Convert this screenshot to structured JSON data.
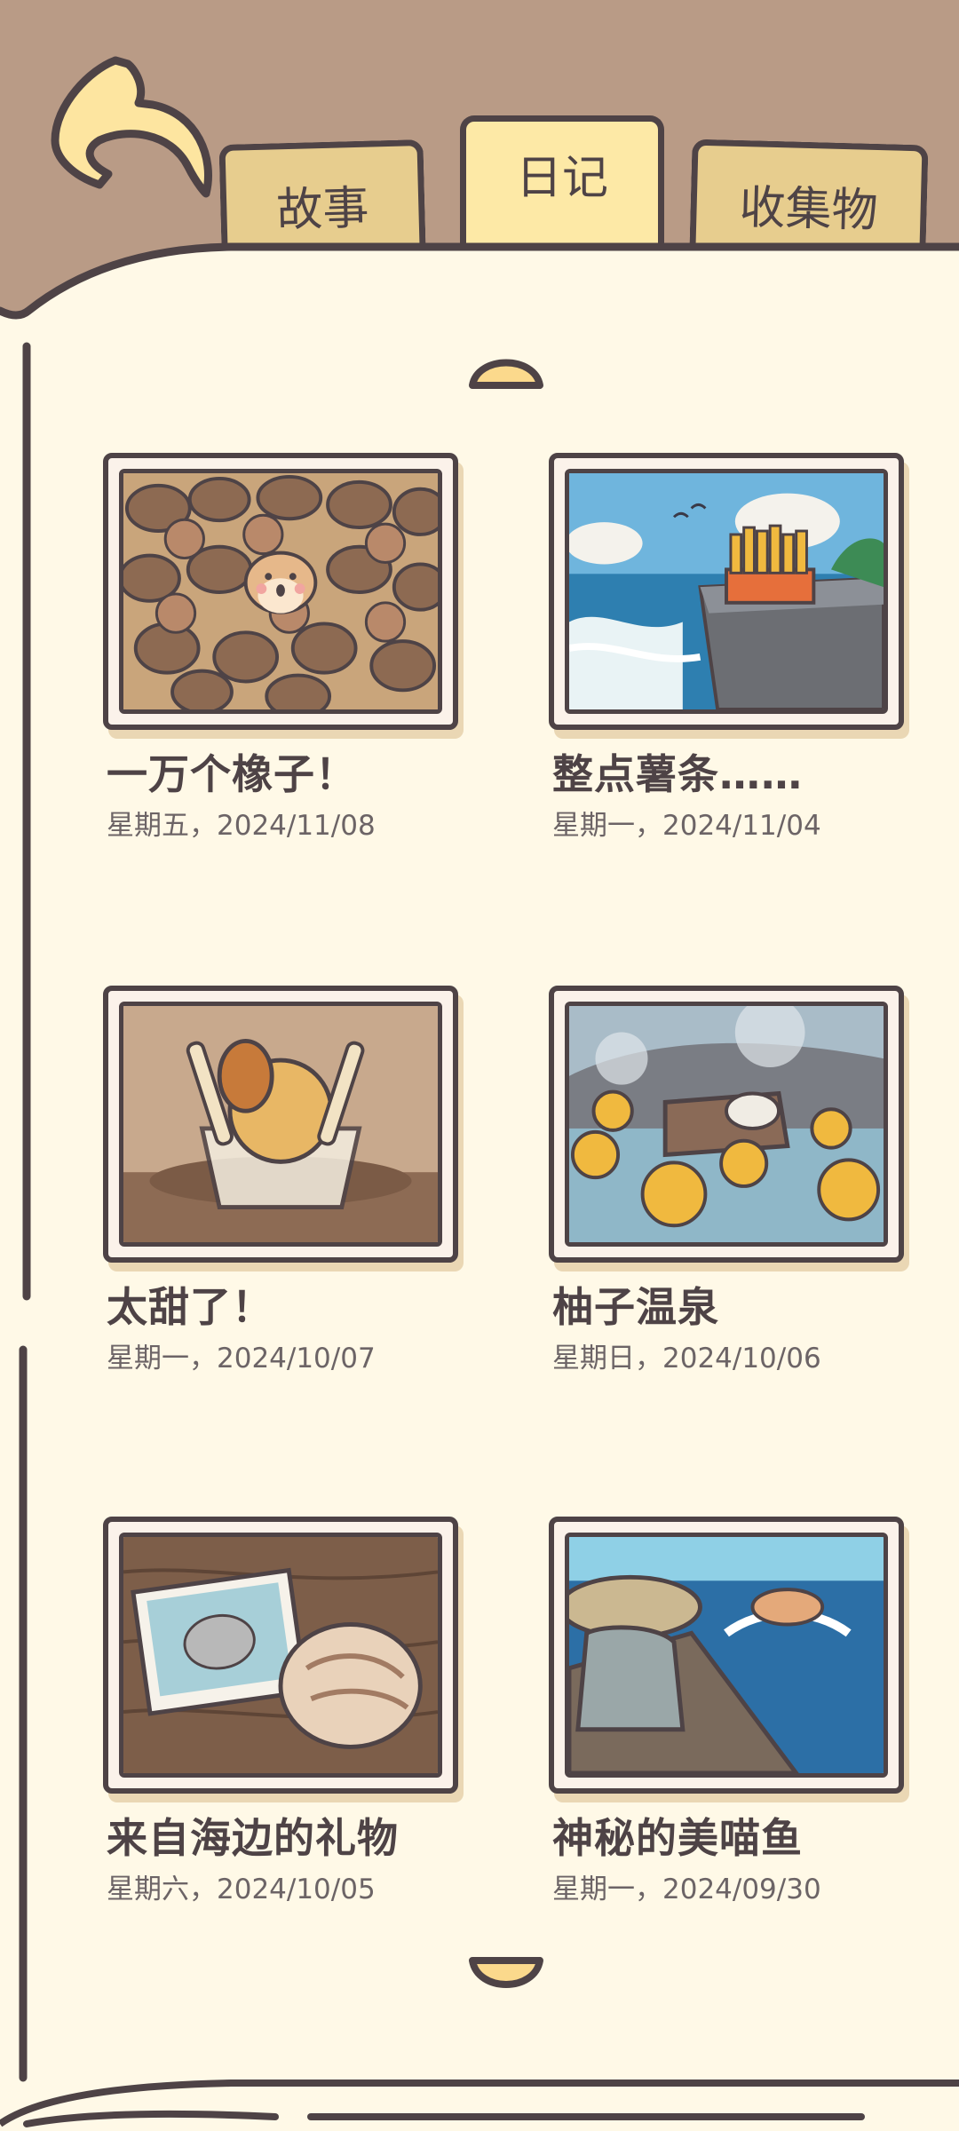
{
  "tabs": [
    {
      "label": "故事"
    },
    {
      "label": "日记"
    },
    {
      "label": "收集物"
    }
  ],
  "active_tab": "日记",
  "entries": [
    {
      "title": "一万个橡子！",
      "date": "星期五，2024/11/08",
      "image": "acorn-pile-squirrel"
    },
    {
      "title": "整点薯条……",
      "date": "星期一，2024/11/04",
      "image": "fries-on-seaside-cliff"
    },
    {
      "title": "太甜了！",
      "date": "星期一，2024/10/07",
      "image": "ice-cream-bowl"
    },
    {
      "title": "柚子温泉",
      "date": "星期日，2024/10/06",
      "image": "yuzu-hot-spring"
    },
    {
      "title": "来自海边的礼物",
      "date": "星期六，2024/10/05",
      "image": "seashell-and-photo"
    },
    {
      "title": "神秘的美喵鱼",
      "date": "星期一，2024/09/30",
      "image": "fishing-boat-jumping-fish"
    }
  ],
  "colors": {
    "background": "#b99b86",
    "page": "#fff9e7",
    "outline": "#4e4346",
    "tab": "#e7cd8e",
    "tab_active": "#fde9a6"
  },
  "icons": {
    "back": "back-arrow-icon",
    "scroll_up": "chevron-up-icon",
    "scroll_down": "chevron-down-icon"
  }
}
